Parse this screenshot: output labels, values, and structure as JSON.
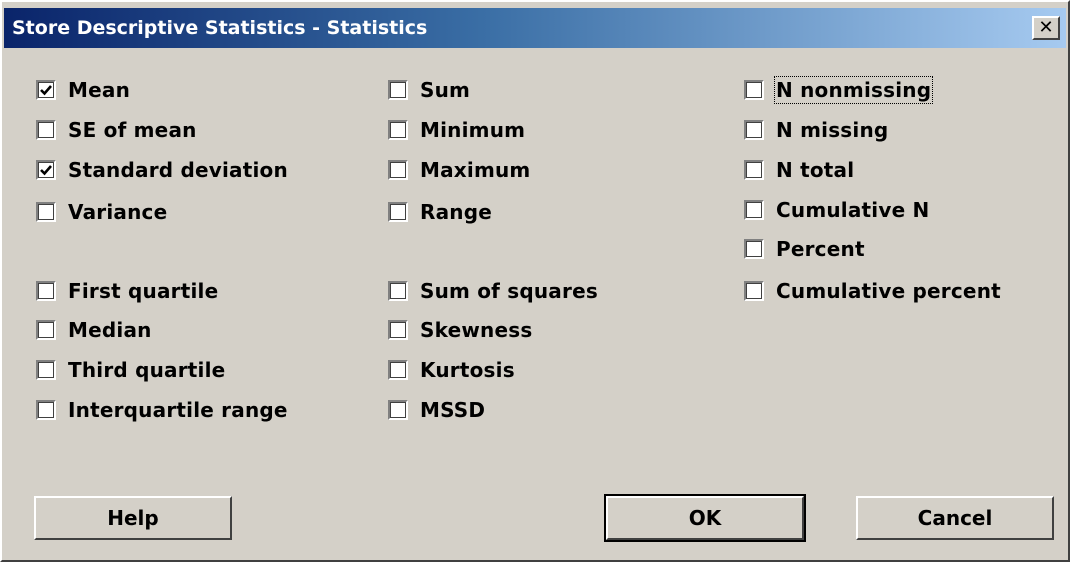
{
  "window": {
    "title": "Store Descriptive Statistics - Statistics",
    "close_symbol": "✕"
  },
  "options": {
    "col1": [
      {
        "label": "Mean",
        "checked": true
      },
      {
        "label": "SE of mean",
        "checked": false
      },
      {
        "label": "Standard deviation",
        "checked": true
      },
      {
        "label": "Variance",
        "checked": false
      },
      {
        "label": "First quartile",
        "checked": false
      },
      {
        "label": "Median",
        "checked": false
      },
      {
        "label": "Third quartile",
        "checked": false
      },
      {
        "label": "Interquartile range",
        "checked": false
      }
    ],
    "col2": [
      {
        "label": "Sum",
        "checked": false
      },
      {
        "label": "Minimum",
        "checked": false
      },
      {
        "label": "Maximum",
        "checked": false
      },
      {
        "label": "Range",
        "checked": false
      },
      {
        "label": "Sum of squares",
        "checked": false
      },
      {
        "label": "Skewness",
        "checked": false
      },
      {
        "label": "Kurtosis",
        "checked": false
      },
      {
        "label": "MSSD",
        "checked": false
      }
    ],
    "col3": [
      {
        "label": "N nonmissing",
        "checked": false
      },
      {
        "label": "N missing",
        "checked": false
      },
      {
        "label": "N total",
        "checked": false
      },
      {
        "label": "Cumulative N",
        "checked": false
      },
      {
        "label": "Percent",
        "checked": false
      },
      {
        "label": "Cumulative percent",
        "checked": false
      }
    ]
  },
  "buttons": {
    "help": "Help",
    "ok": "OK",
    "cancel": "Cancel"
  }
}
